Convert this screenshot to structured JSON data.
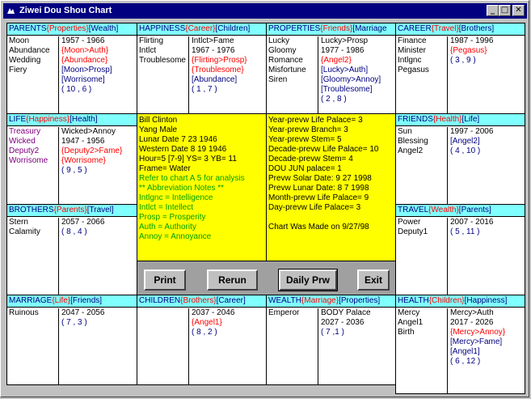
{
  "window": {
    "title": "Ziwei  Dou Shou Chart"
  },
  "palaces": {
    "parents": {
      "h1": "PARENTS",
      "h2": "{Properties}",
      "h3": "[Wealth]",
      "left": [
        {
          "t": "Moon",
          "c": "blk"
        },
        {
          "t": "Abundance",
          "c": "blk"
        },
        {
          "t": "Wedding",
          "c": "blk"
        },
        {
          "t": "Fiery",
          "c": "blk"
        }
      ],
      "right": [
        {
          "t": "1957 - 1966",
          "c": "blk"
        },
        {
          "t": "{Moon>Auth}",
          "c": "red"
        },
        {
          "t": "{Abundance}",
          "c": "red"
        },
        {
          "t": "[Moon>Prosp]",
          "c": "blu"
        },
        {
          "t": "[Worrisome]",
          "c": "blu"
        },
        {
          "t": "( 10 , 6 )",
          "c": "blu"
        }
      ]
    },
    "happiness": {
      "h1": "HAPPINESS",
      "h2": "{Career}",
      "h3": "[Children]",
      "left": [
        {
          "t": "Flirting",
          "c": "blk"
        },
        {
          "t": "Intlct",
          "c": "blk"
        },
        {
          "t": "Troublesome",
          "c": "blk"
        }
      ],
      "right": [
        {
          "t": "Intlct>Fame",
          "c": "blk"
        },
        {
          "t": " 1967 - 1976",
          "c": "blk"
        },
        {
          "t": "{Flirting>Prosp}",
          "c": "red"
        },
        {
          "t": "{Troublesome}",
          "c": "red"
        },
        {
          "t": "[Abundance]",
          "c": "blu"
        },
        {
          "t": "( 1 , 7 )",
          "c": "blu"
        }
      ]
    },
    "properties": {
      "h1": "PROPERTIES",
      "h2": "{Friends}",
      "h3": "[Marriage",
      "left": [
        {
          "t": "Lucky",
          "c": "blk"
        },
        {
          "t": "Gloomy",
          "c": "blk"
        },
        {
          "t": "Romance",
          "c": "blk"
        },
        {
          "t": "Misfortune",
          "c": "blk"
        },
        {
          "t": "Siren",
          "c": "blk"
        }
      ],
      "right": [
        {
          "t": "Lucky>Prosp",
          "c": "blk"
        },
        {
          "t": " 1977 - 1986",
          "c": "blk"
        },
        {
          "t": "{Angel2}",
          "c": "red"
        },
        {
          "t": "[Lucky>Auth]",
          "c": "blu"
        },
        {
          "t": "[Gloomy>Annoy]",
          "c": "blu"
        },
        {
          "t": "[Troublesome]",
          "c": "blu"
        },
        {
          "t": "( 2 , 8 )",
          "c": "blu"
        }
      ]
    },
    "career": {
      "h1": "CAREER",
      "h2": "{Travel}",
      "h3": "[Brothers]",
      "left": [
        {
          "t": "Finance",
          "c": "blk"
        },
        {
          "t": "Minister",
          "c": "blk"
        },
        {
          "t": "Intlgnc",
          "c": "blk"
        },
        {
          "t": "Pegasus",
          "c": "blk"
        }
      ],
      "right": [
        {
          "t": "1987 - 1996",
          "c": "blk"
        },
        {
          "t": "{Pegasus}",
          "c": "red"
        },
        {
          "t": "( 3 , 9 )",
          "c": "blu"
        }
      ]
    },
    "life": {
      "h1": "LIFE",
      "h2": "{Happiness}",
      "h3": "[Health]",
      "left": [
        {
          "t": "Treasury",
          "c": "pur"
        },
        {
          "t": "Wicked",
          "c": "pur"
        },
        {
          "t": "Deputy2",
          "c": "pur"
        },
        {
          "t": "Worrisome",
          "c": "pur"
        }
      ],
      "right": [
        {
          "t": "Wicked>Annoy",
          "c": "blk"
        },
        {
          "t": " 1947 - 1956",
          "c": "blk"
        },
        {
          "t": "{Deputy2>Fame}",
          "c": "red"
        },
        {
          "t": "{Worrisome}",
          "c": "red"
        },
        {
          "t": "( 9 , 5 )",
          "c": "blu"
        }
      ]
    },
    "friends": {
      "h1": "FRIENDS",
      "h2": "{Health}",
      "h3": "[Life]",
      "left": [
        {
          "t": "Sun",
          "c": "blk"
        },
        {
          "t": "Blessing",
          "c": "blk"
        },
        {
          "t": "Angel2",
          "c": "blk"
        }
      ],
      "right": [
        {
          "t": "1997 - 2006",
          "c": "blk"
        },
        {
          "t": "[Angel2]",
          "c": "blu"
        },
        {
          "t": "( 4 , 10 )",
          "c": "blu"
        }
      ]
    },
    "brothers": {
      "h1": "BROTHERS",
      "h2": "{Parents}",
      "h3": "[Travel]",
      "left": [
        {
          "t": "Stern",
          "c": "blk"
        },
        {
          "t": "Calamity",
          "c": "blk"
        }
      ],
      "right": [
        {
          "t": "2057 - 2066",
          "c": "blk"
        },
        {
          "t": "( 8 , 4 )",
          "c": "blu"
        }
      ]
    },
    "travel": {
      "h1": "TRAVEL",
      "h2": "{Wealth}",
      "h3": "[Parents]",
      "left": [
        {
          "t": "Power",
          "c": "blk"
        },
        {
          "t": "Deputy1",
          "c": "blk"
        }
      ],
      "right": [
        {
          "t": "2007 - 2016",
          "c": "blk"
        },
        {
          "t": "( 5 , 11 )",
          "c": "blu"
        }
      ]
    },
    "marriage": {
      "h1": "MARRIAGE",
      "h2": "{Life}",
      "h3": "[Friends]",
      "left": [
        {
          "t": "Ruinous",
          "c": "blk"
        }
      ],
      "right": [
        {
          "t": "2047 - 2056",
          "c": "blk"
        },
        {
          "t": "( 7 , 3 )",
          "c": "blu"
        }
      ]
    },
    "children": {
      "h1": "CHILDREN",
      "h2": "{Brothers}",
      "h3": "[Career]",
      "left": [],
      "right": [
        {
          "t": "2037 - 2046",
          "c": "blk"
        },
        {
          "t": "{Angel1}",
          "c": "red"
        },
        {
          "t": "( 8 , 2 )",
          "c": "blu"
        }
      ]
    },
    "wealth": {
      "h1": "WEALTH",
      "h2": "{Marriage}",
      "h3": "[Properties]",
      "left": [
        {
          "t": "Emperor",
          "c": "blk"
        }
      ],
      "right": [
        {
          "t": "BODY Palace",
          "c": "blk"
        },
        {
          "t": " 2027 - 2036",
          "c": "blk"
        },
        {
          "t": "( 7 ,1 )",
          "c": "blu"
        }
      ]
    },
    "health": {
      "h1": "HEALTH",
      "h2": "{Children}",
      "h3": "[Happiness]",
      "left": [
        {
          "t": "Mercy",
          "c": "blk"
        },
        {
          "t": "Angel1",
          "c": "blk"
        },
        {
          "t": "Birth",
          "c": "blk"
        }
      ],
      "right": [
        {
          "t": "Mercy>Auth",
          "c": "blk"
        },
        {
          "t": " 2017 - 2026",
          "c": "blk"
        },
        {
          "t": "{Mercy>Annoy}",
          "c": "red"
        },
        {
          "t": "[Mercy>Fame]",
          "c": "blu"
        },
        {
          "t": "[Angel1]",
          "c": "blu"
        },
        {
          "t": "( 6 , 12 )",
          "c": "blu"
        }
      ]
    }
  },
  "info_left": [
    {
      "t": "Bill Clinton",
      "c": "blk"
    },
    {
      "t": "Yang Male",
      "c": "blk"
    },
    {
      "t": "Lunar Date 7  23  1946",
      "c": "blk"
    },
    {
      "t": "Western Date 8  19  1946",
      "c": "blk"
    },
    {
      "t": "Hour=5 [7-9] YS= 3  YB= 11",
      "c": "blk"
    },
    {
      "t": "Frame= Water",
      "c": "blk"
    },
    {
      "t": "Refer to chart A 5  for analysis",
      "c": "grn"
    },
    {
      "t": "** Abbreviation Notes **",
      "c": "grn"
    },
    {
      "t": "Intlgnc = Intelligence",
      "c": "grn"
    },
    {
      "t": "Intlct = Intellect",
      "c": "grn"
    },
    {
      "t": "Prosp = Prosperity",
      "c": "grn"
    },
    {
      "t": "Auth = Authority",
      "c": "grn"
    },
    {
      "t": "Annoy = Annoyance",
      "c": "grn"
    }
  ],
  "info_right": [
    {
      "t": "Year-prevw Life Palace= 3",
      "c": "blk"
    },
    {
      "t": "Year-prevw Branch= 3",
      "c": "blk"
    },
    {
      "t": "Year-prevw Stem= 5",
      "c": "blk"
    },
    {
      "t": "Decade-prevw Life Palace= 10",
      "c": "blk"
    },
    {
      "t": "Decade-prevw Stem= 4",
      "c": "blk"
    },
    {
      "t": "DOU JUN palace=  1",
      "c": "blk"
    },
    {
      "t": "Prevw Solar Date:  9  27  1998",
      "c": "blk"
    },
    {
      "t": "Prevw Lunar Date:  8  7  1998",
      "c": "blk"
    },
    {
      "t": "Month-prevw Life Palace=  9",
      "c": "blk"
    },
    {
      "t": "Day-prevw Life Palace=  3",
      "c": "blk"
    },
    {
      "t": "",
      "c": "blk"
    },
    {
      "t": "Chart Was Made on 9/27/98",
      "c": "blk"
    }
  ],
  "buttons": {
    "print": "Print",
    "rerun": "Rerun",
    "daily": "Daily Prw",
    "exit": "Exit"
  },
  "colors": {
    "header_bg": "#80ffff",
    "info_bg": "#ffff00",
    "title_bg": "#000080",
    "branch_color": "#ff0000",
    "bracket_color": "#000080",
    "note_color": "#00a000"
  }
}
